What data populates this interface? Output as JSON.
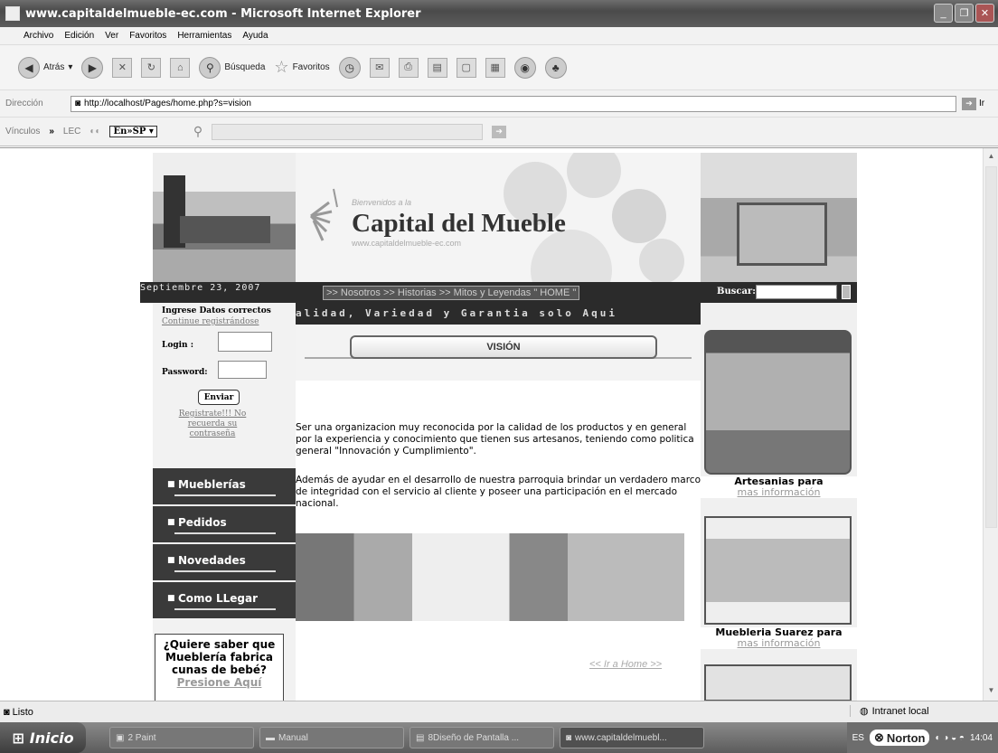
{
  "window": {
    "title": "www.capitaldelmueble-ec.com - Microsoft Internet Explorer",
    "controls": [
      "_",
      "❐",
      "✕"
    ]
  },
  "menu": [
    "Archivo",
    "Edición",
    "Ver",
    "Favoritos",
    "Herramientas",
    "Ayuda"
  ],
  "toolbar": {
    "back": "Atrás",
    "search": "Búsqueda",
    "favorites": "Favoritos"
  },
  "address": {
    "label": "Dirección",
    "url": "http://localhost/Pages/home.php?s=vision",
    "go": "Ir"
  },
  "links": {
    "label": "Vínculos",
    "chevron": "»",
    "lec": "LEC",
    "translate": "En»SP ▾"
  },
  "site": {
    "banner": {
      "welcome": "Bienvenidos a la",
      "brand": "Capital del Mueble",
      "url": "www.capitaldelmueble-ec.com"
    },
    "date": "Septiembre 23, 2007",
    "nav": {
      "items": [
        ">> Nosotros",
        ">> Historias",
        ">> Mitos y Leyendas",
        "\" HOME \""
      ]
    },
    "search": {
      "label": "Buscar:"
    },
    "login": {
      "heading": "Ingrese Datos correctos",
      "sub": "Continue registrándose",
      "login_label": "Login :",
      "password_label": "Password:",
      "submit": "Enviar",
      "register": "Registrate!!!  No recuerda su contraseña"
    },
    "side_nav": [
      "Mueblerías",
      "Pedidos",
      "Novedades",
      "Como LLegar"
    ],
    "promo": {
      "question": "¿Quiere saber que Mueblería fabrica cunas de bebé?",
      "press": "Presione Aquí"
    },
    "slogan": "alidad, Variedad y Garantia solo Aqui",
    "section_title": "VISIÓN",
    "para1": "Ser una organizacion muy reconocida por la calidad de los productos y en general por la experiencia y conocimiento que tienen sus artesanos, teniendo como politica general \"Innovación y Cumplimiento\".",
    "para2": "Además de ayudar en el desarrollo de nuestra parroquia brindar un verdadero marco de integridad con el servicio al cliente y poseer una participación en el mercado nacional.",
    "home_link": "<< Ir a Home >>",
    "ads": [
      {
        "title": "Artesanias para",
        "more": "mas información"
      },
      {
        "title": "Muebleria Suarez para",
        "more": "mas información"
      }
    ]
  },
  "status": {
    "text": "Listo",
    "zone": "Intranet local"
  },
  "taskbar": {
    "start": "Inicio",
    "tasks": [
      "2 Paint",
      "Manual",
      "8Diseño de Pantalla ...",
      "www.capitaldelmuebl..."
    ],
    "lang": "ES",
    "norton": "Norton",
    "clock": "14:04"
  }
}
